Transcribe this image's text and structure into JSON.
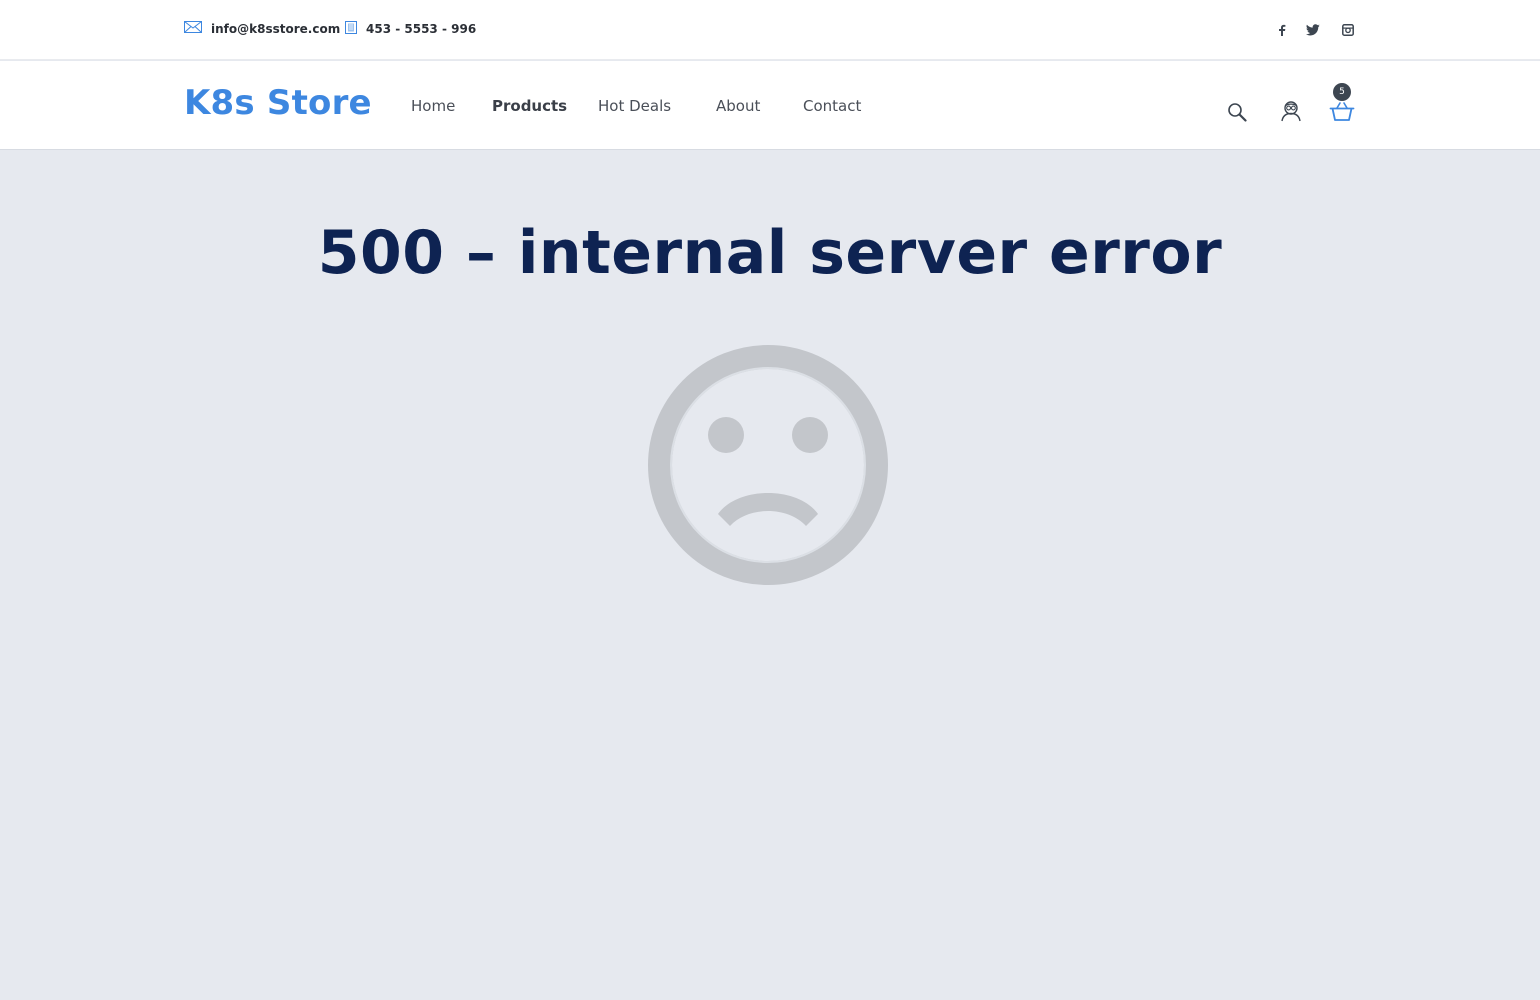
{
  "topbar": {
    "email": "info@k8sstore.com",
    "phone": "453 - 5553 - 996",
    "social": [
      "facebook-icon",
      "twitter-icon",
      "instagram-icon"
    ]
  },
  "header": {
    "logo": "K8s Store",
    "nav": [
      {
        "label": "Home",
        "active": false
      },
      {
        "label": "Products",
        "active": true
      },
      {
        "label": "Hot Deals",
        "active": false
      },
      {
        "label": "About",
        "active": false
      },
      {
        "label": "Contact",
        "active": false
      }
    ],
    "icons": [
      "search-icon",
      "user-icon",
      "cart-icon"
    ],
    "cart_count": "5"
  },
  "error": {
    "title": "500 – internal server error",
    "icon": "sad-face-icon"
  },
  "colors": {
    "brand": "#3d87e0",
    "title": "#0e2352",
    "background": "#e6e9ef",
    "face": "#c3c6cb"
  }
}
